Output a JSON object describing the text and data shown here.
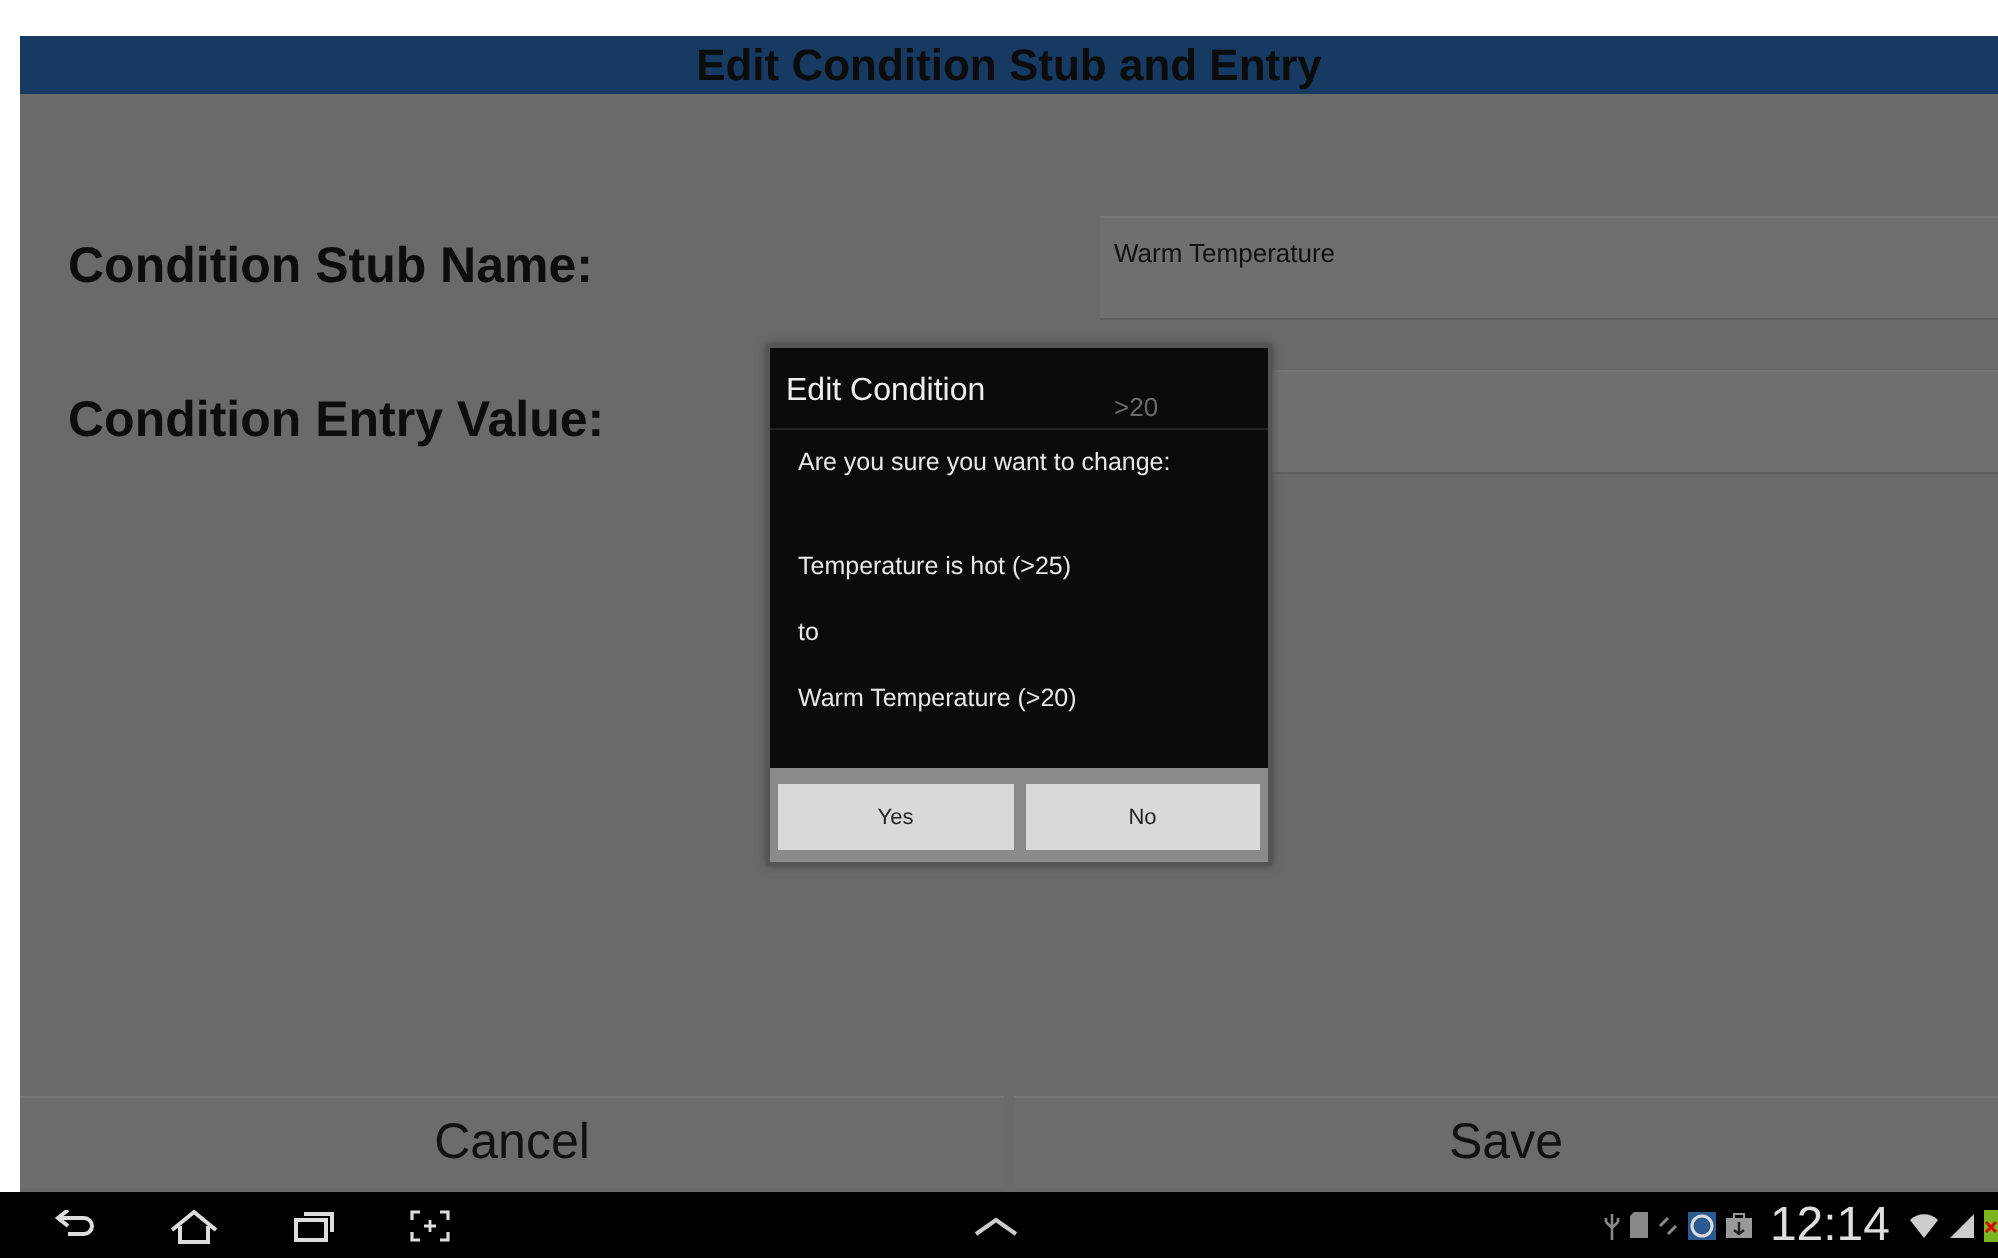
{
  "app_bar": {
    "title": "Edit Condition Stub and Entry"
  },
  "form": [
    {
      "label": "Condition Stub Name:",
      "value": "Warm Temperature"
    },
    {
      "label": "Condition Entry Value:",
      "value": ">20"
    }
  ],
  "footer_buttons": [
    "Cancel",
    "Save"
  ],
  "dialog": {
    "title": "Edit Condition",
    "lines": [
      "Are you sure you want to change:",
      "Temperature is hot (>25)",
      "to",
      "Warm Temperature (>20)"
    ],
    "buttons": [
      "Yes",
      "No"
    ]
  },
  "status_bar": {
    "time": "12:14"
  }
}
